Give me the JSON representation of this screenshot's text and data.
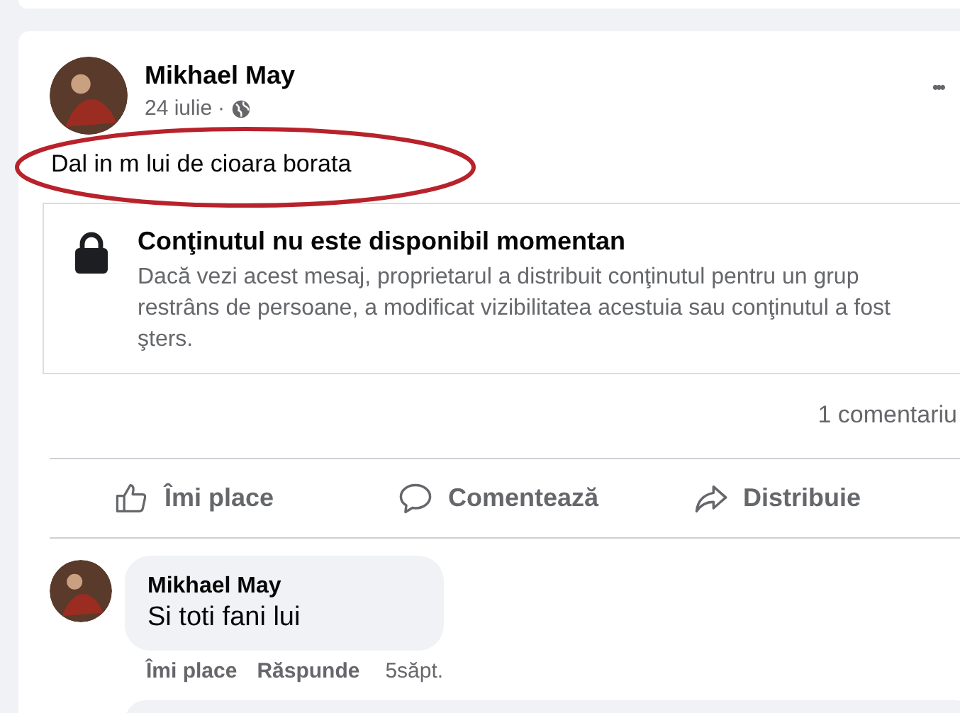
{
  "post": {
    "author": "Mikhael May",
    "date": "24 iulie",
    "separator": "·",
    "text": "Dal in m lui de cioara borata",
    "more": "•••",
    "unavailable": {
      "title": "Conţinutul nu este disponibil momentan",
      "body": "Dacă vezi acest mesaj, proprietarul a distribuit conţinutul pentru un grup restrâns de persoane, a modificat vizibilitatea acestuia sau conţinutul a fost şters."
    },
    "comment_count": "1 comentariu",
    "actions": [
      {
        "kind": "like",
        "label": "Îmi place"
      },
      {
        "kind": "comment",
        "label": "Comentează"
      },
      {
        "kind": "share",
        "label": "Distribuie"
      }
    ]
  },
  "comments": [
    {
      "author": "Mikhael May",
      "text": "Si toti fani lui",
      "actions": [
        "Îmi place",
        "Răspunde"
      ],
      "time": "5săpt."
    }
  ]
}
